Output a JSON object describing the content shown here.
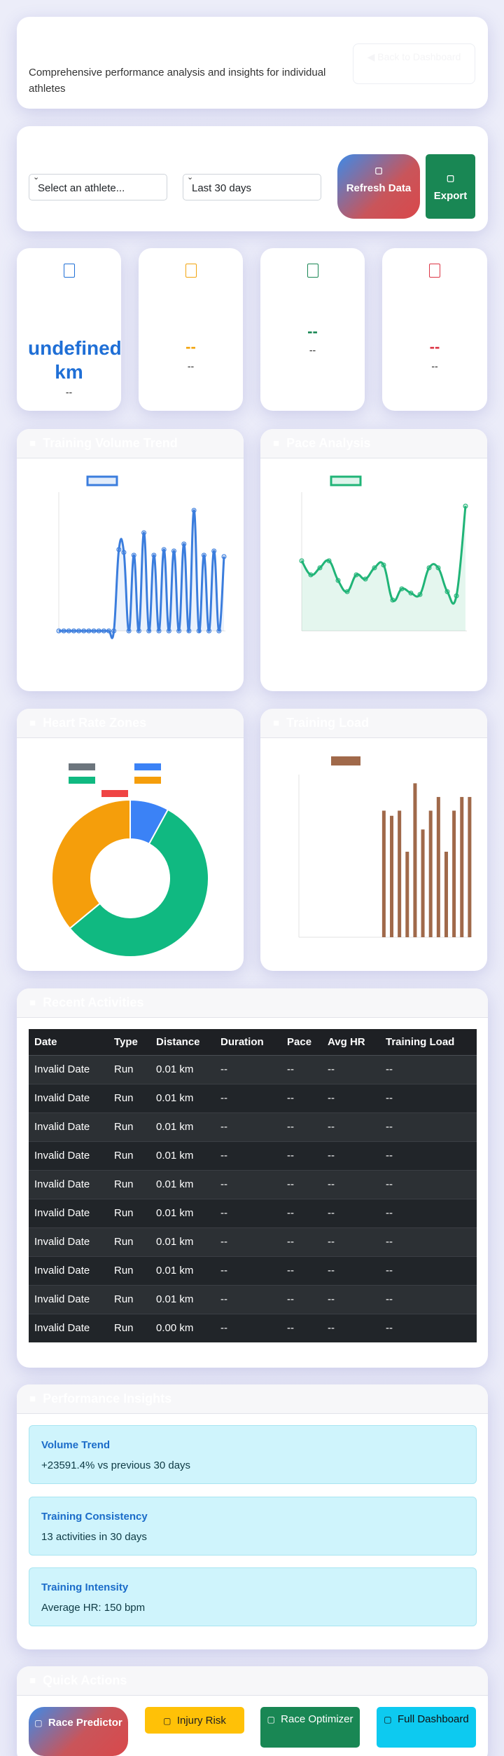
{
  "header": {
    "description": "Comprehensive performance analysis and insights for individual athletes",
    "back_label": "Back to Dashboard"
  },
  "controls": {
    "athlete_select": "Select an athlete...",
    "range_select": "Last 30 days",
    "refresh_label": "Refresh Data",
    "export_label": "Export"
  },
  "stats": [
    {
      "value": "undefined km",
      "label": "--",
      "color": "#1f6fd6"
    },
    {
      "value": "--",
      "label": "--",
      "color": "#f2a40e"
    },
    {
      "value": "--",
      "label": "--",
      "color": "#198754"
    },
    {
      "value": "--",
      "label": "--",
      "color": "#dc3545"
    }
  ],
  "charts": {
    "volume_title": "Training Volume Trend",
    "pace_title": "Pace Analysis",
    "hr_title": "Heart Rate Zones",
    "load_title": "Training Load"
  },
  "chart_data": [
    {
      "type": "line",
      "title": "Training Volume Trend",
      "color": "#3b7ddd",
      "ylim": [
        0,
        1
      ],
      "values": [
        0,
        0,
        0,
        0,
        0,
        0,
        0,
        0,
        0,
        0,
        0,
        0,
        0.58,
        0.56,
        0,
        0.54,
        0,
        0.7,
        0,
        0.54,
        0,
        0.58,
        0,
        0.57,
        0,
        0.62,
        0,
        0.86,
        0,
        0.54,
        0,
        0.57,
        0,
        0.53
      ],
      "grid": false
    },
    {
      "type": "area",
      "title": "Pace Analysis",
      "color": "#20b477",
      "ylim": [
        0,
        1
      ],
      "values": [
        0.5,
        0.4,
        0.45,
        0.5,
        0.36,
        0.28,
        0.4,
        0.37,
        0.45,
        0.47,
        0.22,
        0.3,
        0.27,
        0.26,
        0.45,
        0.45,
        0.28,
        0.25,
        0.89
      ],
      "grid": false
    },
    {
      "type": "pie",
      "title": "Heart Rate Zones",
      "legend": "top",
      "colors": [
        "#6c757d",
        "#3b82f6",
        "#10b981",
        "#f59e0b",
        "#ef4444"
      ],
      "values": [
        0,
        8,
        56,
        36,
        0
      ]
    },
    {
      "type": "bar",
      "title": "Training Load",
      "color": "#a0694a",
      "ylim": [
        0,
        1
      ],
      "values": [
        0,
        0,
        0,
        0,
        0,
        0,
        0,
        0,
        0,
        0,
        0,
        0,
        0,
        0,
        0,
        0,
        0,
        0,
        0,
        0,
        0,
        0.74,
        0,
        0.71,
        0,
        0.74,
        0,
        0.5,
        0,
        0.9,
        0,
        0.63,
        0,
        0.74,
        0,
        0.82,
        0,
        0.5,
        0,
        0.74,
        0,
        0.82,
        0,
        0.82
      ]
    }
  ],
  "activities": {
    "title": "Recent Activities",
    "columns": [
      "Date",
      "Type",
      "Distance",
      "Duration",
      "Pace",
      "Avg HR",
      "Training Load"
    ],
    "rows": [
      [
        "Invalid Date",
        "Run",
        "0.01 km",
        "--",
        "--",
        "--",
        "--"
      ],
      [
        "Invalid Date",
        "Run",
        "0.01 km",
        "--",
        "--",
        "--",
        "--"
      ],
      [
        "Invalid Date",
        "Run",
        "0.01 km",
        "--",
        "--",
        "--",
        "--"
      ],
      [
        "Invalid Date",
        "Run",
        "0.01 km",
        "--",
        "--",
        "--",
        "--"
      ],
      [
        "Invalid Date",
        "Run",
        "0.01 km",
        "--",
        "--",
        "--",
        "--"
      ],
      [
        "Invalid Date",
        "Run",
        "0.01 km",
        "--",
        "--",
        "--",
        "--"
      ],
      [
        "Invalid Date",
        "Run",
        "0.01 km",
        "--",
        "--",
        "--",
        "--"
      ],
      [
        "Invalid Date",
        "Run",
        "0.01 km",
        "--",
        "--",
        "--",
        "--"
      ],
      [
        "Invalid Date",
        "Run",
        "0.01 km",
        "--",
        "--",
        "--",
        "--"
      ],
      [
        "Invalid Date",
        "Run",
        "0.00 km",
        "--",
        "--",
        "--",
        "--"
      ]
    ]
  },
  "insights": {
    "title": "Performance Insights",
    "items": [
      {
        "title": "Volume Trend",
        "text": "+23591.4% vs previous 30 days"
      },
      {
        "title": "Training Consistency",
        "text": "13 activities in 30 days"
      },
      {
        "title": "Training Intensity",
        "text": "Average HR: 150 bpm"
      }
    ]
  },
  "quick_actions": {
    "title": "Quick Actions",
    "race_predictor": "Race Predictor",
    "injury_risk": "Injury Risk",
    "race_optimizer": "Race Optimizer",
    "full_dashboard": "Full Dashboard"
  }
}
